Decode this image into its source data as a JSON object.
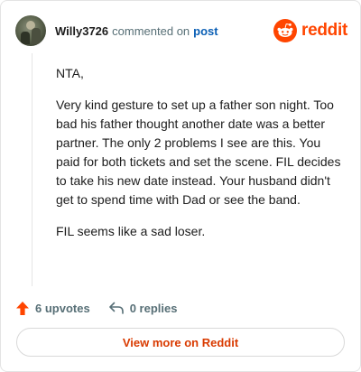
{
  "header": {
    "username": "Willy3726",
    "verb": "commented on",
    "post_link": "post",
    "brand_name": "reddit",
    "brand_color": "#ff4500"
  },
  "comment": {
    "paragraphs": [
      "NTA,",
      "Very kind gesture to set up a father son night. Too bad his father thought another date was a better partner. The only 2 problems I see are this. You paid for both tickets and set the scene. FIL decides to take his new date instead. Your husband didn't get to spend time with Dad or see the band.",
      "FIL seems like a sad loser."
    ]
  },
  "actions": {
    "upvotes_label": "6 upvotes",
    "replies_label": "0 replies",
    "upvote_icon": "arrow-up-icon",
    "reply_icon": "reply-arrow-icon",
    "upvote_color": "#ff4500"
  },
  "footer": {
    "view_more_label": "View more on Reddit",
    "view_more_color": "#d93a00"
  }
}
